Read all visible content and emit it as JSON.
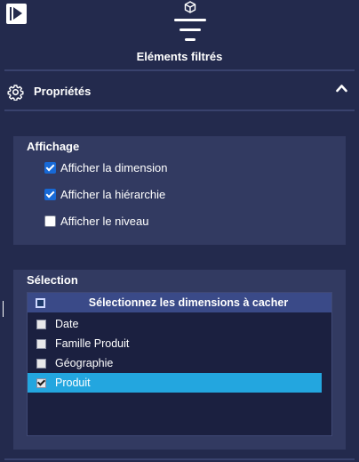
{
  "header": {
    "title": "Eléments filtrés",
    "icons": [
      "panel-toggle-icon",
      "cube-icon",
      "filter-icon"
    ]
  },
  "properties": {
    "title": "Propriétés",
    "icon": "gear-icon",
    "collapse_icon": "chevron-up-icon"
  },
  "display_section": {
    "title": "Affichage",
    "options": [
      {
        "label": "Afficher la dimension",
        "checked": true
      },
      {
        "label": "Afficher la hiérarchie",
        "checked": true
      },
      {
        "label": "Afficher le niveau",
        "checked": false
      }
    ]
  },
  "selection_section": {
    "title": "Sélection",
    "list_header": "Sélectionnez les dimensions à cacher",
    "items": [
      {
        "label": "Date",
        "checked": false,
        "selected": false
      },
      {
        "label": "Famille Produit",
        "checked": false,
        "selected": false
      },
      {
        "label": "Géographie",
        "checked": false,
        "selected": false
      },
      {
        "label": "Produit",
        "checked": true,
        "selected": true
      }
    ]
  },
  "colors": {
    "background": "#232a4d",
    "section": "#323a61",
    "selected_row": "#23a6df",
    "list_header": "#3a4a88",
    "checkbox_checked": "#1769d6"
  }
}
